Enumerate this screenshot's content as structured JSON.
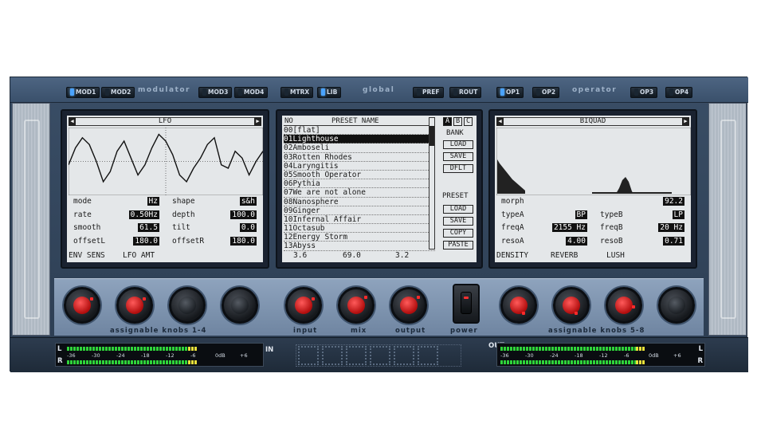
{
  "tabs": {
    "modulator_label": "modulator",
    "global_label": "global",
    "operator_label": "operator",
    "buttons": [
      "MOD1",
      "MOD2",
      "MOD3",
      "MOD4",
      "MTRX",
      "LIB",
      "PREF",
      "ROUT",
      "OP1",
      "OP2",
      "OP3",
      "OP4"
    ],
    "active": [
      "MOD1",
      "LIB",
      "OP1"
    ]
  },
  "lfo_screen": {
    "title": "LFO",
    "left_arrow": "◀",
    "right_arrow": "▶",
    "waveform": [
      0.55,
      0.3,
      0.15,
      0.25,
      0.5,
      0.8,
      0.65,
      0.35,
      0.2,
      0.45,
      0.7,
      0.55,
      0.3,
      0.1,
      0.2,
      0.4,
      0.7,
      0.8,
      0.6,
      0.45,
      0.25,
      0.15,
      0.55,
      0.6,
      0.35,
      0.45,
      0.7,
      0.5,
      0.35
    ],
    "params": [
      {
        "label_l": "mode",
        "value_l": "Hz",
        "label_r": "shape",
        "value_r": "s&h"
      },
      {
        "label_l": "rate",
        "value_l": "0.50Hz",
        "label_r": "depth",
        "value_r": "100.0"
      },
      {
        "label_l": "smooth",
        "value_l": "61.5",
        "label_r": "tilt",
        "value_r": "0.0"
      },
      {
        "label_l": "offsetL",
        "value_l": "180.0",
        "label_r": "offsetR",
        "value_r": "180.0"
      }
    ],
    "knob_labels": [
      "ENV SENS",
      "LFO AMT"
    ]
  },
  "preset_screen": {
    "col_no": "NO",
    "col_name": "PRESET NAME",
    "presets": [
      {
        "no": "00",
        "name": "[flat]"
      },
      {
        "no": "01",
        "name": "Lighthouse"
      },
      {
        "no": "02",
        "name": "Amboseli"
      },
      {
        "no": "03",
        "name": "Rotten Rhodes"
      },
      {
        "no": "04",
        "name": "Laryngitis"
      },
      {
        "no": "05",
        "name": "Smooth Operator"
      },
      {
        "no": "06",
        "name": "Pythia"
      },
      {
        "no": "07",
        "name": "We are not alone"
      },
      {
        "no": "08",
        "name": "Nanosphere"
      },
      {
        "no": "09",
        "name": "Ginger"
      },
      {
        "no": "10",
        "name": "Infernal Affair"
      },
      {
        "no": "11",
        "name": "Octasub"
      },
      {
        "no": "12",
        "name": "Energy Storm"
      },
      {
        "no": "13",
        "name": "Abyss"
      }
    ],
    "selected_index": 1,
    "banks": [
      "A",
      "B",
      "C"
    ],
    "active_bank": "A",
    "bank_label": "BANK",
    "bank_buttons": [
      "LOAD",
      "SAVE",
      "DFLT"
    ],
    "preset_label": "PRESET",
    "preset_buttons": [
      "LOAD",
      "SAVE",
      "COPY",
      "PASTE"
    ],
    "readouts": [
      "3.6",
      "69.0",
      "3.2"
    ]
  },
  "biquad_screen": {
    "title": "BIQUAD",
    "left_arrow": "◀",
    "right_arrow": "▶",
    "morph_label": "morph",
    "morph_value": "92.2",
    "params": [
      {
        "label_l": "typeA",
        "value_l": "BP",
        "label_r": "typeB",
        "value_r": "LP"
      },
      {
        "label_l": "freqA",
        "value_l": "2155 Hz",
        "label_r": "freqB",
        "value_r": "20 Hz"
      },
      {
        "label_l": "resoA",
        "value_l": "4.00",
        "label_r": "resoB",
        "value_r": "0.71"
      }
    ],
    "knob_labels": [
      "DENSITY",
      "REVERB",
      "LUSH"
    ]
  },
  "knobs": {
    "group1_label": "assignable knobs 1-4",
    "input_label": "input",
    "mix_label": "mix",
    "output_label": "output",
    "power_label": "power",
    "group2_label": "assignable knobs 5-8"
  },
  "meters": {
    "in_scale": [
      "-36",
      "-30",
      "-24",
      "-18",
      "-12",
      "-6",
      "0dB",
      "+6"
    ],
    "out_scale": [
      "-36",
      "-30",
      "-24",
      "-18",
      "-12",
      "-6",
      "0dB",
      "+6"
    ],
    "in_level_l": 0.72,
    "in_level_r": 0.72,
    "out_level_l": 0.8,
    "out_level_r": 0.8,
    "left_ch": "L",
    "right_ch": "R",
    "in_label": "IN",
    "out_label": "OUT"
  },
  "colors": {
    "accent_led": "#4aa3ff",
    "knob_red": "#d01818",
    "screen_bg": "#e4e7e9"
  }
}
